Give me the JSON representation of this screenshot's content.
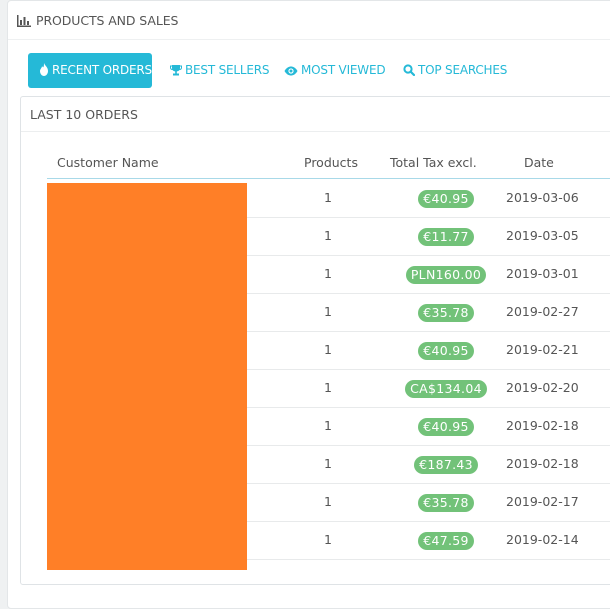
{
  "panel": {
    "title": "PRODUCTS AND SALES"
  },
  "tabs": [
    {
      "label": "RECENT ORDERS",
      "icon": "fire-icon",
      "active": true
    },
    {
      "label": "BEST SELLERS",
      "icon": "trophy-icon",
      "active": false
    },
    {
      "label": "MOST VIEWED",
      "icon": "eye-icon",
      "active": false
    },
    {
      "label": "TOP SEARCHES",
      "icon": "search-icon",
      "active": false
    }
  ],
  "orders": {
    "title": "LAST 10 ORDERS",
    "columns": [
      "Customer Name",
      "Products",
      "Total Tax excl.",
      "Date"
    ],
    "rows": [
      {
        "products": "1",
        "total": "€40.95",
        "date": "2019-03-06"
      },
      {
        "products": "1",
        "total": "€11.77",
        "date": "2019-03-05"
      },
      {
        "products": "1",
        "total": "PLN160.00",
        "date": "2019-03-01"
      },
      {
        "products": "1",
        "total": "€35.78",
        "date": "2019-02-27"
      },
      {
        "products": "1",
        "total": "€40.95",
        "date": "2019-02-21"
      },
      {
        "products": "1",
        "total": "CA$134.04",
        "date": "2019-02-20"
      },
      {
        "products": "1",
        "total": "€40.95",
        "date": "2019-02-18"
      },
      {
        "products": "1",
        "total": "€187.43",
        "date": "2019-02-18"
      },
      {
        "products": "1",
        "total": "€35.78",
        "date": "2019-02-17"
      },
      {
        "products": "1",
        "total": "€47.59",
        "date": "2019-02-14"
      }
    ]
  },
  "colors": {
    "accent": "#25b9d7",
    "badge": "#72c279",
    "redaction": "#ff7f27"
  }
}
